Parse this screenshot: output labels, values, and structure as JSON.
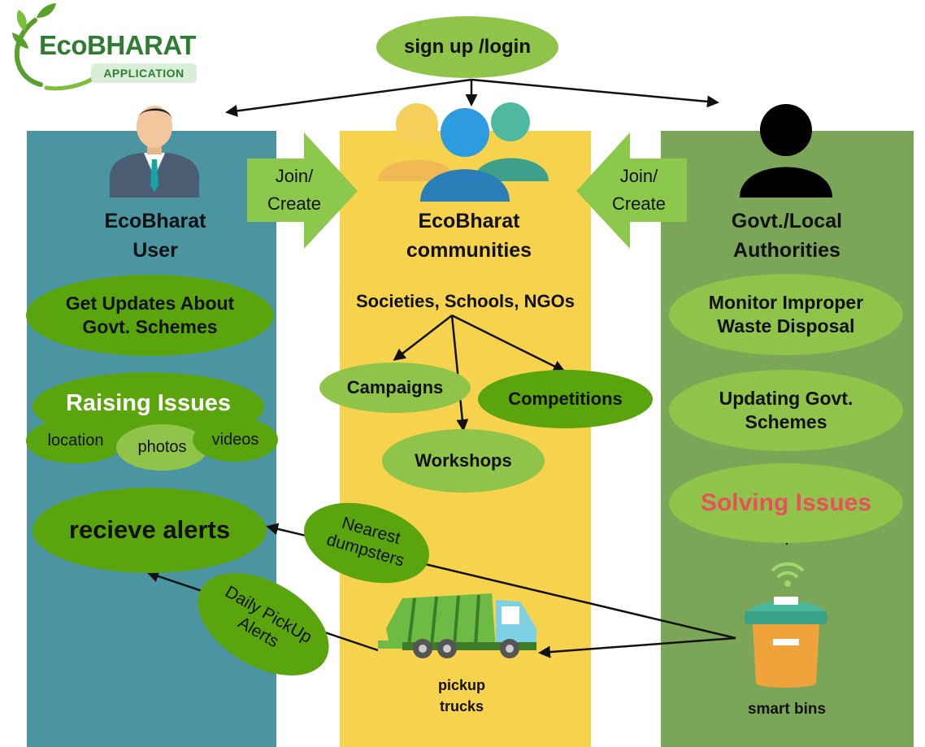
{
  "logo": {
    "name": "EcoBHARAT",
    "tag": "APPLICATION"
  },
  "signup": "sign up /login",
  "columns": {
    "user": {
      "title_line1": "EcoBharat",
      "title_line2": "User",
      "updates": "Get Updates About Govt. Schemes",
      "raising": "Raising Issues",
      "raising_items": [
        "location",
        "photos",
        "videos"
      ],
      "alerts": "recieve alerts"
    },
    "communities": {
      "title_line1": "EcoBharat",
      "title_line2": "communities",
      "members": "Societies, Schools, NGOs",
      "activities": [
        "Campaigns",
        "Competitions",
        "Workshops"
      ],
      "truck_label_line1": "pickup",
      "truck_label_line2": "trucks"
    },
    "govt": {
      "title_line1": "Govt./Local",
      "title_line2": "Authorities",
      "monitor": "Monitor Improper Waste Disposal",
      "updating": "Updating Govt. Schemes",
      "solving": "Solving Issues",
      "bins_label": "smart bins"
    }
  },
  "join_left": {
    "line1": "Join/",
    "line2": "Create"
  },
  "join_right": {
    "line1": "Join/",
    "line2": "Create"
  },
  "notes": {
    "nearest_line1": "Nearest",
    "nearest_line2": "dumpsters",
    "daily_line1": "Daily PickUp",
    "daily_line2": "Alerts"
  },
  "colors": {
    "user_column": "#4a95a1",
    "communities_column": "#f7d24c",
    "govt_column": "#7ca657",
    "ellipse_dark": "#5aa50d",
    "ellipse_light": "#8fc34a",
    "join_arrow": "#8cc84b",
    "solving_text": "#e8505b"
  },
  "icons": [
    "leaf-logo-icon",
    "user-person-icon",
    "community-group-icon",
    "authority-person-icon",
    "garbage-truck-icon",
    "smart-bin-icon",
    "wifi-signal-icon"
  ]
}
